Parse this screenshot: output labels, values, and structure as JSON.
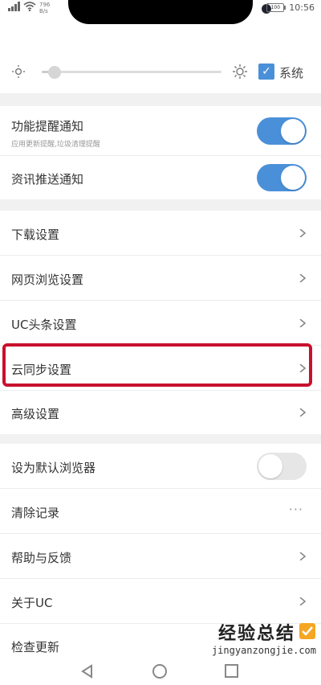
{
  "status_bar": {
    "net_speed": "796\nB/s",
    "battery": "100",
    "time": "10:56"
  },
  "brightness": {
    "level": 0.07,
    "system_label": "系统",
    "system_checked": true
  },
  "toggles": [
    {
      "label": "功能提醒通知",
      "sub": "应用更新提醒,垃圾清理提醒",
      "on": true
    },
    {
      "label": "资讯推送通知",
      "on": true
    }
  ],
  "nav_items": [
    {
      "label": "下载设置"
    },
    {
      "label": "网页浏览设置"
    },
    {
      "label": "UC头条设置"
    },
    {
      "label": "云同步设置",
      "highlighted": true
    },
    {
      "label": "高级设置"
    }
  ],
  "misc_items": [
    {
      "label": "设为默认浏览器",
      "control": "toggle",
      "on": false
    },
    {
      "label": "清除记录",
      "control": "more",
      "more_glyph": "···"
    },
    {
      "label": "帮助与反馈",
      "control": "chevron"
    },
    {
      "label": "关于UC",
      "control": "chevron"
    },
    {
      "label": "检查更新",
      "control": "none"
    }
  ],
  "colors": {
    "accent": "#4a90d9",
    "highlight": "#c8102e",
    "toggle_off": "#e6e6e6",
    "background": "#f1f1f1"
  },
  "watermark": {
    "title": "经验总结",
    "url": "jingyanzongjie.com"
  }
}
